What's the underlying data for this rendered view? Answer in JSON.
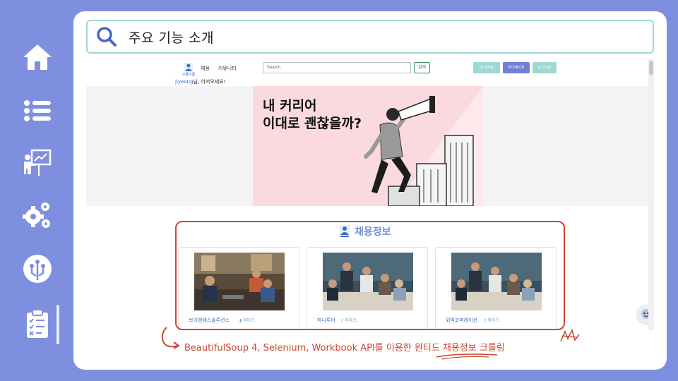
{
  "sidebar": {
    "items": [
      {
        "name": "home",
        "icon": "home-icon"
      },
      {
        "name": "list",
        "icon": "list-icon"
      },
      {
        "name": "presentation",
        "icon": "presentation-icon"
      },
      {
        "name": "settings",
        "icon": "gears-icon"
      },
      {
        "name": "network",
        "icon": "circuit-icon"
      },
      {
        "name": "clipboard",
        "icon": "clipboard-checklist-icon",
        "active": true
      }
    ]
  },
  "header": {
    "title": "주요 기능 소개",
    "icon": "search-icon"
  },
  "site": {
    "logo_caption": "구름이름",
    "nav": [
      "채용",
      "커뮤니티"
    ],
    "search_placeholder": "Search",
    "search_button": "검색",
    "buttons": [
      "Id 게시판",
      "마이페이지",
      "로그아웃"
    ],
    "welcome_user": "jiyeong",
    "welcome_suffix": "님, 어서오세요!",
    "banner_text": "내 커리어\n이대로 괜찮을까?",
    "jobs_title": "채용정보",
    "cards": [
      {
        "company": "브이엠에스솔루션스",
        "bookmark": "북마크"
      },
      {
        "company": "하나투어",
        "bookmark": "북마크"
      },
      {
        "company": "위픽코퍼레이션",
        "bookmark": "북마크"
      }
    ]
  },
  "annotation": {
    "caption": "BeautifulSoup 4, Selenium, Workbook API를 이용한 원티드 채용정보 크롤링"
  },
  "colors": {
    "background": "#7f8fe0",
    "accent_red": "#c8472f",
    "brand_blue": "#6f8fd6",
    "teal_border": "#9fd6d6"
  }
}
